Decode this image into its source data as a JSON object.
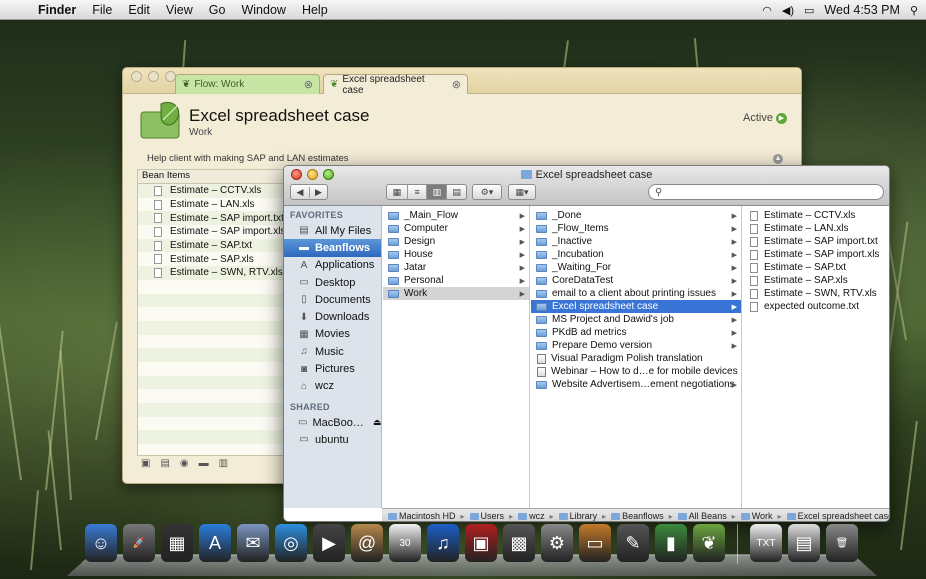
{
  "menubar": {
    "app_name": "Finder",
    "menus": [
      "File",
      "Edit",
      "View",
      "Go",
      "Window",
      "Help"
    ],
    "clock": "Wed 4:53 PM"
  },
  "flow_window": {
    "tabs": [
      {
        "label": "Flow: Work"
      },
      {
        "label": "Excel spreadsheet case"
      }
    ],
    "title": "Excel spreadsheet case",
    "subtitle": "Work",
    "status": "Active",
    "description": "Help client with making SAP and LAN estimates",
    "list_header": "Bean Items",
    "items": [
      "Estimate – CCTV.xls",
      "Estimate – LAN.xls",
      "Estimate – SAP import.txt",
      "Estimate – SAP import.xls",
      "Estimate – SAP.txt",
      "Estimate – SAP.xls",
      "Estimate – SWN, RTV.xls"
    ]
  },
  "finder": {
    "title": "Excel spreadsheet case",
    "sidebar": {
      "favorites_header": "FAVORITES",
      "favorites": [
        {
          "label": "All My Files",
          "icon": "all-files-icon",
          "glyph": "▤"
        },
        {
          "label": "Beanflows",
          "icon": "folder-icon",
          "glyph": "▬"
        },
        {
          "label": "Applications",
          "icon": "applications-icon",
          "glyph": "A"
        },
        {
          "label": "Desktop",
          "icon": "desktop-icon",
          "glyph": "▭"
        },
        {
          "label": "Documents",
          "icon": "documents-icon",
          "glyph": "▯"
        },
        {
          "label": "Downloads",
          "icon": "downloads-icon",
          "glyph": "⬇"
        },
        {
          "label": "Movies",
          "icon": "movies-icon",
          "glyph": "▦"
        },
        {
          "label": "Music",
          "icon": "music-icon",
          "glyph": "♫"
        },
        {
          "label": "Pictures",
          "icon": "pictures-icon",
          "glyph": "◙"
        },
        {
          "label": "wcz",
          "icon": "home-icon",
          "glyph": "⌂"
        }
      ],
      "shared_header": "SHARED",
      "shared": [
        {
          "label": "MacBoo…",
          "icon": "computer-icon",
          "glyph": "▭"
        },
        {
          "label": "ubuntu",
          "icon": "computer-icon",
          "glyph": "▭"
        }
      ]
    },
    "column1": [
      "_Main_Flow",
      "Computer",
      "Design",
      "House",
      "Jatar",
      "Personal",
      "Work"
    ],
    "column2": [
      {
        "label": "_Done",
        "kind": "folder"
      },
      {
        "label": "_Flow_Items",
        "kind": "folder"
      },
      {
        "label": "_Inactive",
        "kind": "folder"
      },
      {
        "label": "_Incubation",
        "kind": "folder"
      },
      {
        "label": "_Waiting_For",
        "kind": "folder"
      },
      {
        "label": "CoreDataTest",
        "kind": "folder"
      },
      {
        "label": "email to a client about printing issues",
        "kind": "folder"
      },
      {
        "label": "Excel spreadsheet case",
        "kind": "folder"
      },
      {
        "label": "MS Project and Dawid's job",
        "kind": "folder"
      },
      {
        "label": "PKdB ad metrics",
        "kind": "folder"
      },
      {
        "label": "Prepare Demo version",
        "kind": "folder"
      },
      {
        "label": "Visual Paradigm Polish translation",
        "kind": "doc"
      },
      {
        "label": "Webinar – How to d…e for mobile devices",
        "kind": "doc"
      },
      {
        "label": "Website Advertisem…ement negotiations",
        "kind": "folder"
      }
    ],
    "column3": [
      "Estimate – CCTV.xls",
      "Estimate – LAN.xls",
      "Estimate – SAP import.txt",
      "Estimate – SAP import.xls",
      "Estimate – SAP.txt",
      "Estimate – SAP.xls",
      "Estimate – SWN, RTV.xls",
      "expected outcome.txt"
    ],
    "path": [
      "Macintosh HD",
      "Users",
      "wcz",
      "Library",
      "Beanflows",
      "All Beans",
      "Work",
      "Excel spreadsheet case"
    ]
  },
  "dock": {
    "icons": [
      {
        "name": "finder-icon",
        "glyph": "☺",
        "color": "#3a7bd5"
      },
      {
        "name": "launchpad-icon",
        "glyph": "🚀",
        "color": "#777"
      },
      {
        "name": "mission-control-icon",
        "glyph": "▦",
        "color": "#333"
      },
      {
        "name": "app-store-icon",
        "glyph": "A",
        "color": "#2a7ddc"
      },
      {
        "name": "mail-icon",
        "glyph": "✉",
        "color": "#7a93c0"
      },
      {
        "name": "safari-icon",
        "glyph": "◎",
        "color": "#2d8fe0"
      },
      {
        "name": "facetime-icon",
        "glyph": "▶",
        "color": "#444"
      },
      {
        "name": "address-book-icon",
        "glyph": "@",
        "color": "#b5884a"
      },
      {
        "name": "ical-icon",
        "glyph": "30",
        "color": "#f1f1f1"
      },
      {
        "name": "itunes-icon",
        "glyph": "♫",
        "color": "#1b5fc6"
      },
      {
        "name": "photo-booth-icon",
        "glyph": "▣",
        "color": "#b01f1f"
      },
      {
        "name": "iphoto-icon",
        "glyph": "▩",
        "color": "#555"
      },
      {
        "name": "system-preferences-icon",
        "glyph": "⚙",
        "color": "#888"
      },
      {
        "name": "keynote-icon",
        "glyph": "▭",
        "color": "#c47a2a"
      },
      {
        "name": "iwork-icon",
        "glyph": "✎",
        "color": "#555"
      },
      {
        "name": "numbers-icon",
        "glyph": "▮",
        "color": "#3c8b3c"
      },
      {
        "name": "beanflows-icon",
        "glyph": "❦",
        "color": "#6ba540"
      },
      {
        "name": "txt-document-icon",
        "glyph": "TXT",
        "color": "#eee"
      },
      {
        "name": "document-stack-icon",
        "glyph": "▤",
        "color": "#ddd"
      },
      {
        "name": "trash-icon",
        "glyph": "🗑",
        "color": "#888"
      }
    ]
  }
}
